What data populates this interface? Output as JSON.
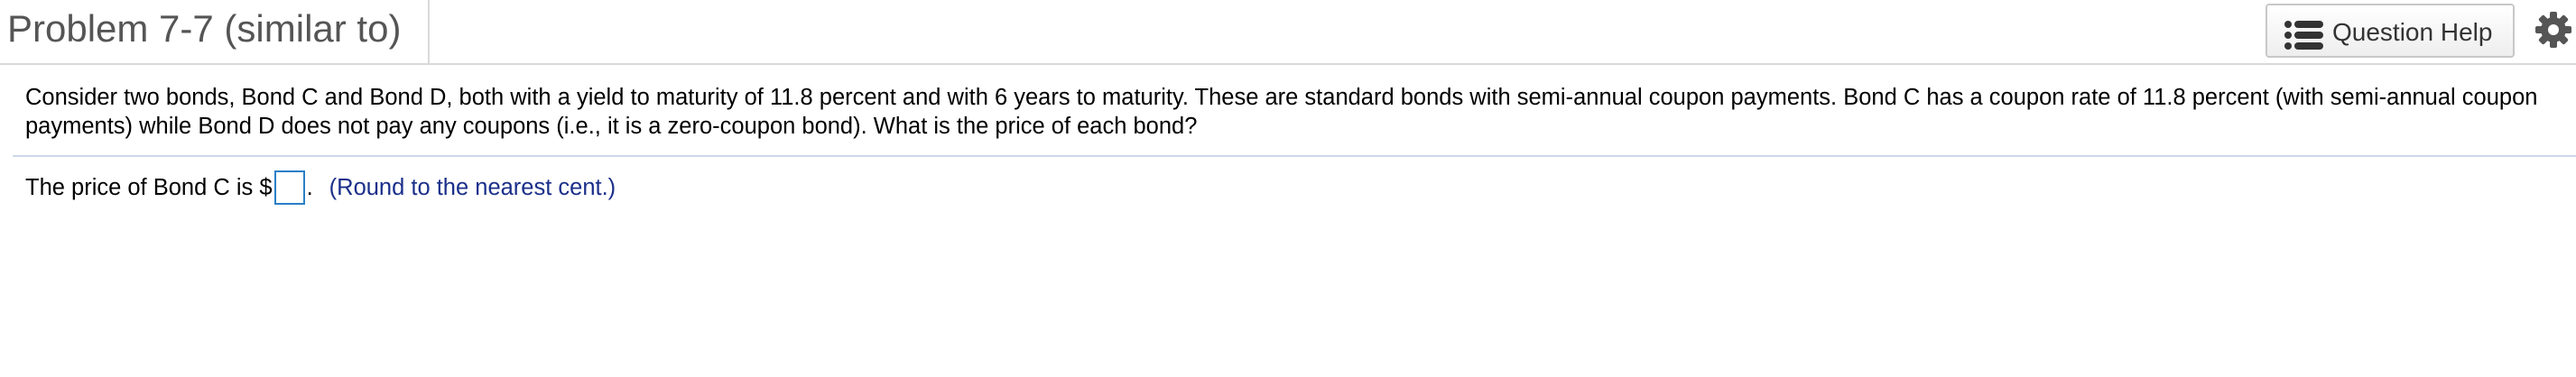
{
  "header": {
    "title": "Problem 7-7 (similar to)",
    "help_button_label": "Question Help",
    "help_icon": "list-icon",
    "settings_icon": "gear-icon"
  },
  "question": {
    "text": "Consider two bonds, Bond C and Bond D, both with a yield to maturity of 11.8 percent and with 6 years to maturity. These are standard bonds with semi-annual coupon payments. Bond C has a coupon rate of 11.8 percent (with semi-annual coupon payments) while Bond D does not pay any coupons (i.e., it is a zero-coupon bond). What is the price of each bond?"
  },
  "answer": {
    "prefix": "The price of Bond C is $",
    "input_value": "",
    "suffix": ".",
    "hint": "(Round to the nearest cent.)"
  },
  "colors": {
    "hint_text": "#1a2f8a",
    "input_border": "#2a7fc7",
    "divider": "#cfd8e8"
  }
}
